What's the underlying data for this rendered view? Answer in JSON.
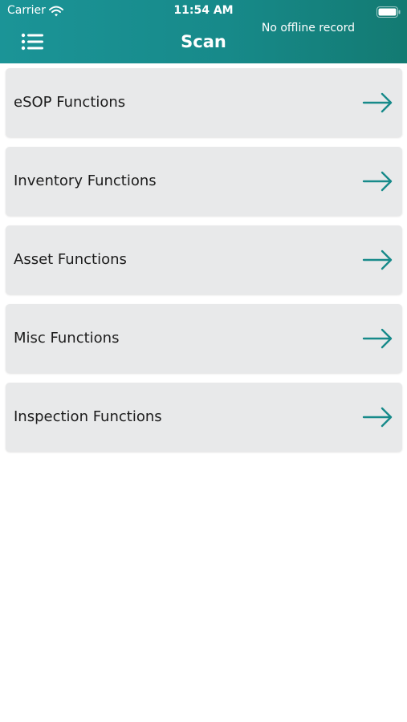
{
  "status_bar": {
    "carrier": "Carrier",
    "time": "11:54 AM",
    "wifi_icon": "wifi-icon",
    "battery_icon": "battery-icon"
  },
  "header": {
    "title": "Scan",
    "offline_status": "No offline record",
    "menu_icon": "hamburger-list-icon",
    "background_color": "#178a8a"
  },
  "functions": [
    {
      "label": "eSOP Functions",
      "icon": "arrow-right-icon"
    },
    {
      "label": "Inventory Functions",
      "icon": "arrow-right-icon"
    },
    {
      "label": "Asset Functions",
      "icon": "arrow-right-icon"
    },
    {
      "label": "Misc Functions",
      "icon": "arrow-right-icon"
    },
    {
      "label": "Inspection Functions",
      "icon": "arrow-right-icon"
    }
  ],
  "colors": {
    "accent": "#178a8a",
    "card_background": "#e8e9ea"
  }
}
